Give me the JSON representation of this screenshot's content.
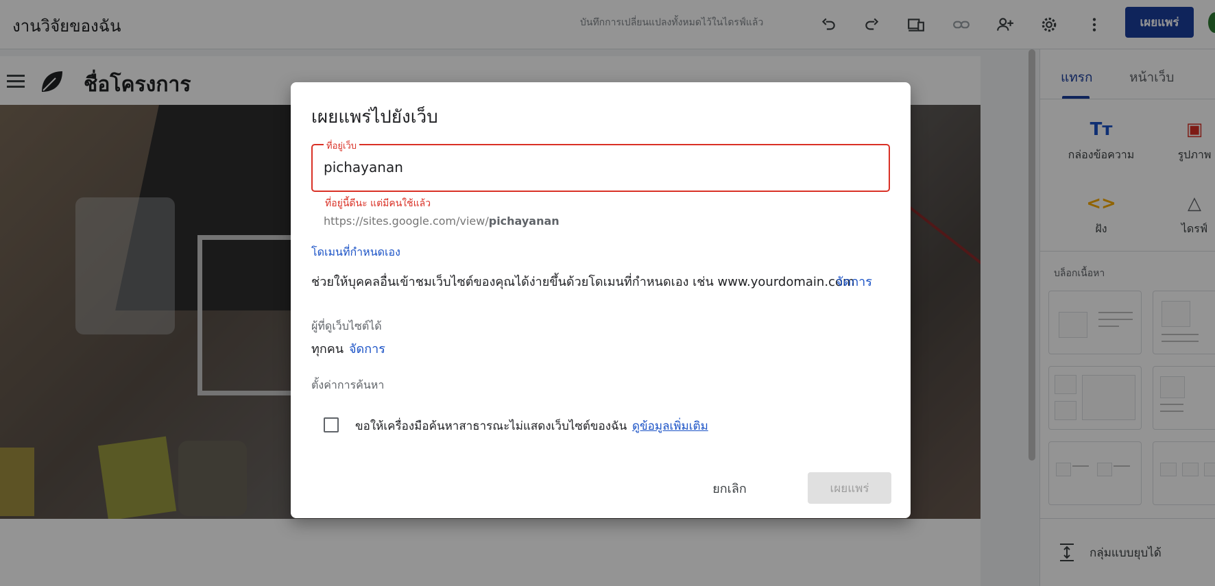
{
  "app": {
    "doc_title": "งานวิจัยของฉัน",
    "save_status": "บันทึกการเปลี่ยนแปลงทั้งหมดไว้ในไดรฟ์แล้ว",
    "publish_label": "เผยแพร่",
    "toolbar_icons": [
      "undo-icon",
      "redo-icon",
      "preview-icon",
      "link-icon",
      "share-icon",
      "settings-icon",
      "more-vert-icon"
    ]
  },
  "site": {
    "project_name": "ชื่อโครงการ"
  },
  "panel": {
    "tabs": [
      "แทรก",
      "หน้าเว็บ"
    ],
    "active_tab": "แทรก",
    "tools": [
      {
        "label": "กล่องข้อความ",
        "icon": "text-box-icon",
        "glyph": "Tт",
        "color": "#1a52c6"
      },
      {
        "label": "รูปภาพ",
        "icon": "image-icon",
        "glyph": "🖼",
        "color": "#d93025"
      },
      {
        "label": "ฝัง",
        "icon": "embed-icon",
        "glyph": "<>",
        "color": "#f9ab00"
      },
      {
        "label": "ไดรฟ์",
        "icon": "drive-icon",
        "glyph": "△",
        "color": "#5f6368"
      }
    ],
    "blocks_label": "บล็อกเนื้อหา",
    "collapsible_label": "กลุ่มแบบยุบได้"
  },
  "dialog": {
    "title": "เผยแพร่ไปยังเว็บ",
    "address_label": "ที่อยู่เว็บ",
    "address_value": "pichayanan",
    "address_error": "ที่อยู่นี้ดีนะ แต่มีคนใช้แล้ว",
    "url_prefix": "https://sites.google.com/view/",
    "url_slug": "pichayanan",
    "custom_domain_label": "โดเมนที่กำหนดเอง",
    "custom_domain_desc": "ช่วยให้บุคคลอื่นเข้าชมเว็บไซต์ของคุณได้ง่ายขึ้นด้วยโดเมนที่กำหนดเอง เช่น www.yourdomain.com",
    "manage_label": "จัดการ",
    "viewers_label": "ผู้ที่ดูเว็บไซต์ได้",
    "viewers_value": "ทุกคน",
    "search_settings_label": "ตั้งค่าการค้นหา",
    "search_checkbox_label": "ขอให้เครื่องมือค้นหาสาธารณะไม่แสดงเว็บไซต์ของฉัน",
    "learn_more": "ดูข้อมูลเพิ่มเติม",
    "search_checkbox_checked": false,
    "cancel_label": "ยกเลิก",
    "publish_label": "เผยแพร่",
    "publish_enabled": false
  }
}
